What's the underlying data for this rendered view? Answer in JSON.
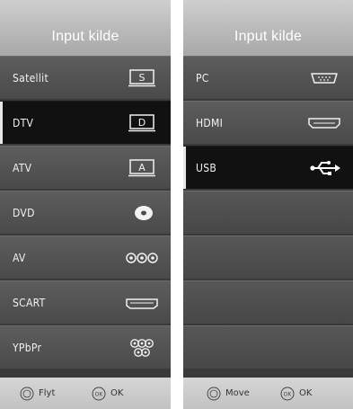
{
  "left_panel": {
    "title": "Input kilde",
    "items": [
      {
        "label": "Satellit",
        "icon": "satellite-s-icon"
      },
      {
        "label": "DTV",
        "icon": "dtv-d-icon",
        "selected": true
      },
      {
        "label": "ATV",
        "icon": "atv-a-icon"
      },
      {
        "label": "DVD",
        "icon": "disc-icon"
      },
      {
        "label": "AV",
        "icon": "av-rca-icon"
      },
      {
        "label": "SCART",
        "icon": "scart-connector-icon"
      },
      {
        "label": "YPbPr",
        "icon": "component-connector-icon"
      }
    ],
    "footer": {
      "move_label": "Flyt",
      "ok_label": "OK",
      "ok_button_text": "OK"
    }
  },
  "right_panel": {
    "title": "Input kilde",
    "items": [
      {
        "label": "PC",
        "icon": "vga-port-icon"
      },
      {
        "label": "HDMI",
        "icon": "hdmi-port-icon"
      },
      {
        "label": "USB",
        "icon": "usb-icon",
        "selected": true
      },
      {
        "label": "",
        "icon": ""
      },
      {
        "label": "",
        "icon": ""
      },
      {
        "label": "",
        "icon": ""
      },
      {
        "label": "",
        "icon": ""
      }
    ],
    "footer": {
      "move_label": "Move",
      "ok_label": "OK",
      "ok_button_text": "OK"
    }
  },
  "icon_letters": {
    "satellite": "S",
    "dtv": "D",
    "atv": "A"
  },
  "colors": {
    "selected_bg": "#111111",
    "item_bg": "#4f4f4f",
    "title_bg": "#bdbdbd"
  }
}
